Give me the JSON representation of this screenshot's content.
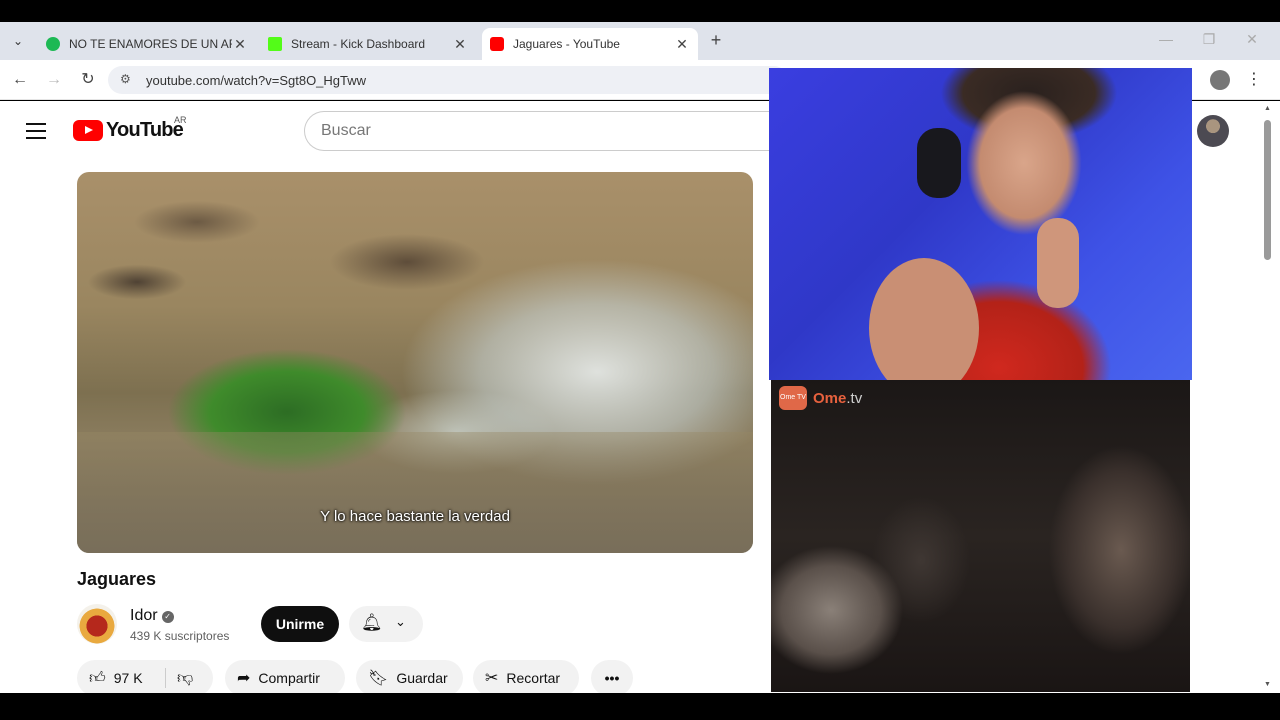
{
  "browser": {
    "tabs": [
      {
        "title": "NO TE ENAMORES DE UN ARTI",
        "favicon_color": "#1db954",
        "active": false
      },
      {
        "title": "Stream - Kick Dashboard",
        "favicon_color": "#53fc18",
        "active": false
      },
      {
        "title": "Jaguares - YouTube",
        "favicon_color": "#ff0000",
        "active": true
      }
    ],
    "url": "youtube.com/watch?v=Sgt8O_HgTww"
  },
  "youtube": {
    "logo_text": "YouTube",
    "country_code": "AR",
    "search_placeholder": "Buscar",
    "video": {
      "subtitle": "Y lo hace bastante la verdad",
      "title": "Jaguares"
    },
    "channel": {
      "name": "Idor",
      "subscribers": "439 K suscriptores",
      "join_label": "Unirme"
    },
    "actions": {
      "likes": "97 K",
      "share_label": "Compartir",
      "save_label": "Guardar",
      "clip_label": "Recortar"
    }
  },
  "overlay": {
    "ome_badge": "Ome TV",
    "ome_brand": "Ome",
    "ome_suffix": ".tv"
  },
  "colors": {
    "youtube_red": "#ff0000",
    "ome_orange": "#e7613e"
  }
}
